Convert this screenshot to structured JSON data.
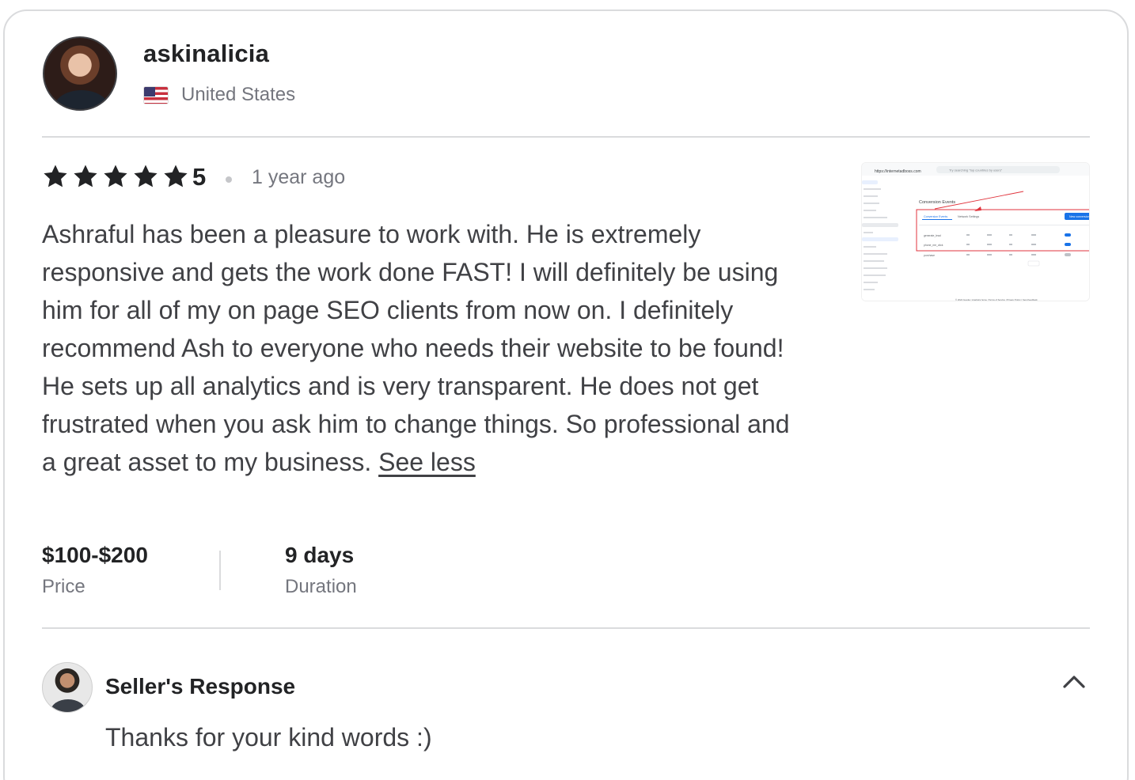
{
  "reviewer": {
    "username": "askinalicia",
    "country": "United States",
    "avatar_icon": "user-avatar",
    "flag_icon": "us-flag-icon"
  },
  "review": {
    "rating": "5",
    "stars_filled": 5,
    "time_ago": "1 year ago",
    "text": "Ashraful has been a pleasure to work with. He is extremely responsive and gets the work done FAST! I will definitely be using him for all of my on page SEO clients from now on. I definitely recommend Ash to everyone who needs their website to be found! He sets up all analytics and is very transparent. He does not get frustrated when you ask him to change things. So professional and a great asset to my business.",
    "see_less_label": "See less"
  },
  "attachment": {
    "url_text": "https://internetadboss.com",
    "search_placeholder": "Try searching \"top countries by users\"",
    "section_title": "Conversion Events",
    "tab_1": "Conversion Events",
    "tab_2": "Network Settings",
    "button": "New conversion",
    "rows": [
      "generate_lead",
      "phone_me_click",
      "purchase"
    ],
    "footer": "© 2024 Google | Analytics home | Terms of Service | Privacy Policy | Send feedback"
  },
  "stats": {
    "price_value": "$100-$200",
    "price_label": "Price",
    "duration_value": "9 days",
    "duration_label": "Duration"
  },
  "seller_response": {
    "title": "Seller's Response",
    "text": "Thanks for your kind words :)",
    "collapse_icon": "chevron-up-icon"
  },
  "colors": {
    "star": "#222325",
    "border": "#dadbdd",
    "muted_text": "#74767e",
    "body_text": "#404145",
    "highlight_red": "#e0333c",
    "google_blue": "#1a73e8"
  }
}
